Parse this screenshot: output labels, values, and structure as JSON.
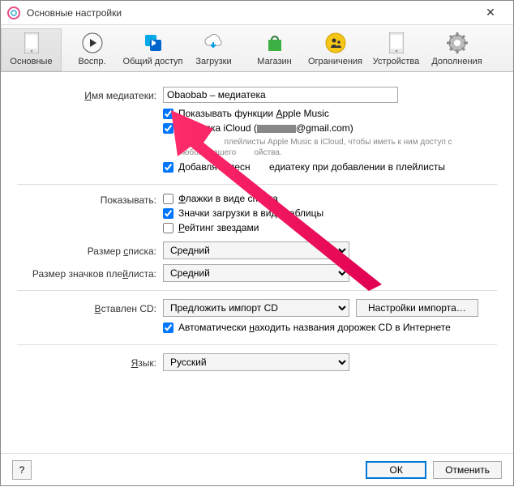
{
  "titlebar": {
    "title": "Основные настройки"
  },
  "toolbar": {
    "items": [
      {
        "label": "Основные"
      },
      {
        "label": "Воспр."
      },
      {
        "label": "Общий доступ"
      },
      {
        "label": "Загрузки"
      },
      {
        "label": "Магазин"
      },
      {
        "label": "Ограничения"
      },
      {
        "label": "Устройства"
      },
      {
        "label": "Дополнения"
      }
    ]
  },
  "form": {
    "library_name_label": "Имя медиатеки:",
    "library_name_value": "Obaobab – медиатека",
    "apple_music_label": "Показывать функции Apple Music",
    "icloud_prefix": "М",
    "icloud_suffix": "ака iCloud (",
    "icloud_email_suffix": "@gmail.com)",
    "icloud_note": "Храните песни и плейлисты Apple Music в iCloud, чтобы иметь к ним доступ с любого Вашего устройства.",
    "add_playlist_prefix": "Добавлять песн",
    "add_playlist_suffix": "едиатеку при добавлении в плейлисты",
    "show_label": "Показывать:",
    "flags_label": "Флажки в виде списка",
    "table_icons_label": "Значки загрузки в виде таблицы",
    "rating_label": "Рейтинг звездами",
    "list_size_label": "Размер списка:",
    "playlist_icons_label": "Размер значков плейлиста:",
    "size_value": "Средний",
    "cd_label": "Вставлен CD:",
    "cd_value": "Предложить импорт CD",
    "import_settings_btn": "Настройки импорта…",
    "auto_find_label": "Автоматически находить названия дорожек CD в Интернете",
    "language_label": "Язык:",
    "language_value": "Русский"
  },
  "buttons": {
    "help": "?",
    "ok": "ОК",
    "cancel": "Отменить"
  }
}
